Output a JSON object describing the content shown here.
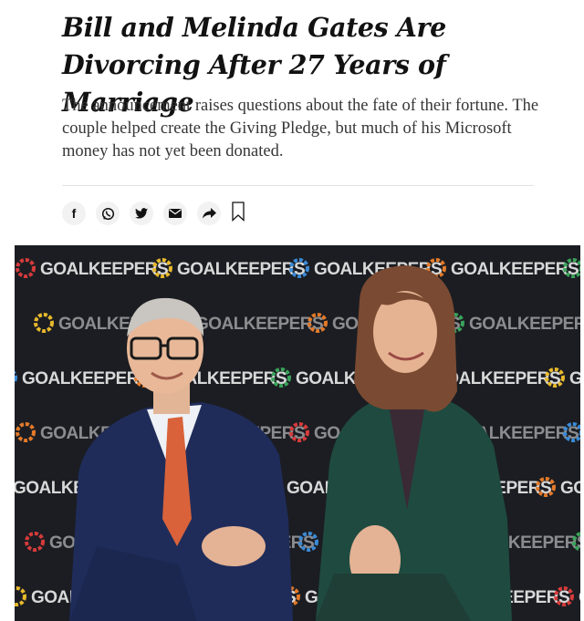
{
  "article": {
    "headline": "Bill and Melinda Gates Are Divorcing After 27 Years of Marriage",
    "summary": "The announcement raises questions about the fate of their fortune. The couple helped create the Giving Pledge, but much of his Microsoft money has not yet been donated."
  },
  "share_tools": [
    {
      "icon": "facebook-icon",
      "glyph": "f"
    },
    {
      "icon": "whatsapp-icon"
    },
    {
      "icon": "twitter-icon"
    },
    {
      "icon": "email-icon"
    },
    {
      "icon": "share-arrow-icon"
    },
    {
      "icon": "bookmark-icon"
    }
  ],
  "photo": {
    "backdrop_word": "GOALKEEPERS"
  },
  "colors": {
    "headline": "#121212",
    "summary": "#363636",
    "icon_bg": "#f2f2f2",
    "backdrop": "#1b1d22",
    "backdrop_text": "#e8e8e8",
    "tie": "#d9623a",
    "jacket_bill": "#1f2c5a",
    "jacket_melinda": "#1f4a40"
  }
}
